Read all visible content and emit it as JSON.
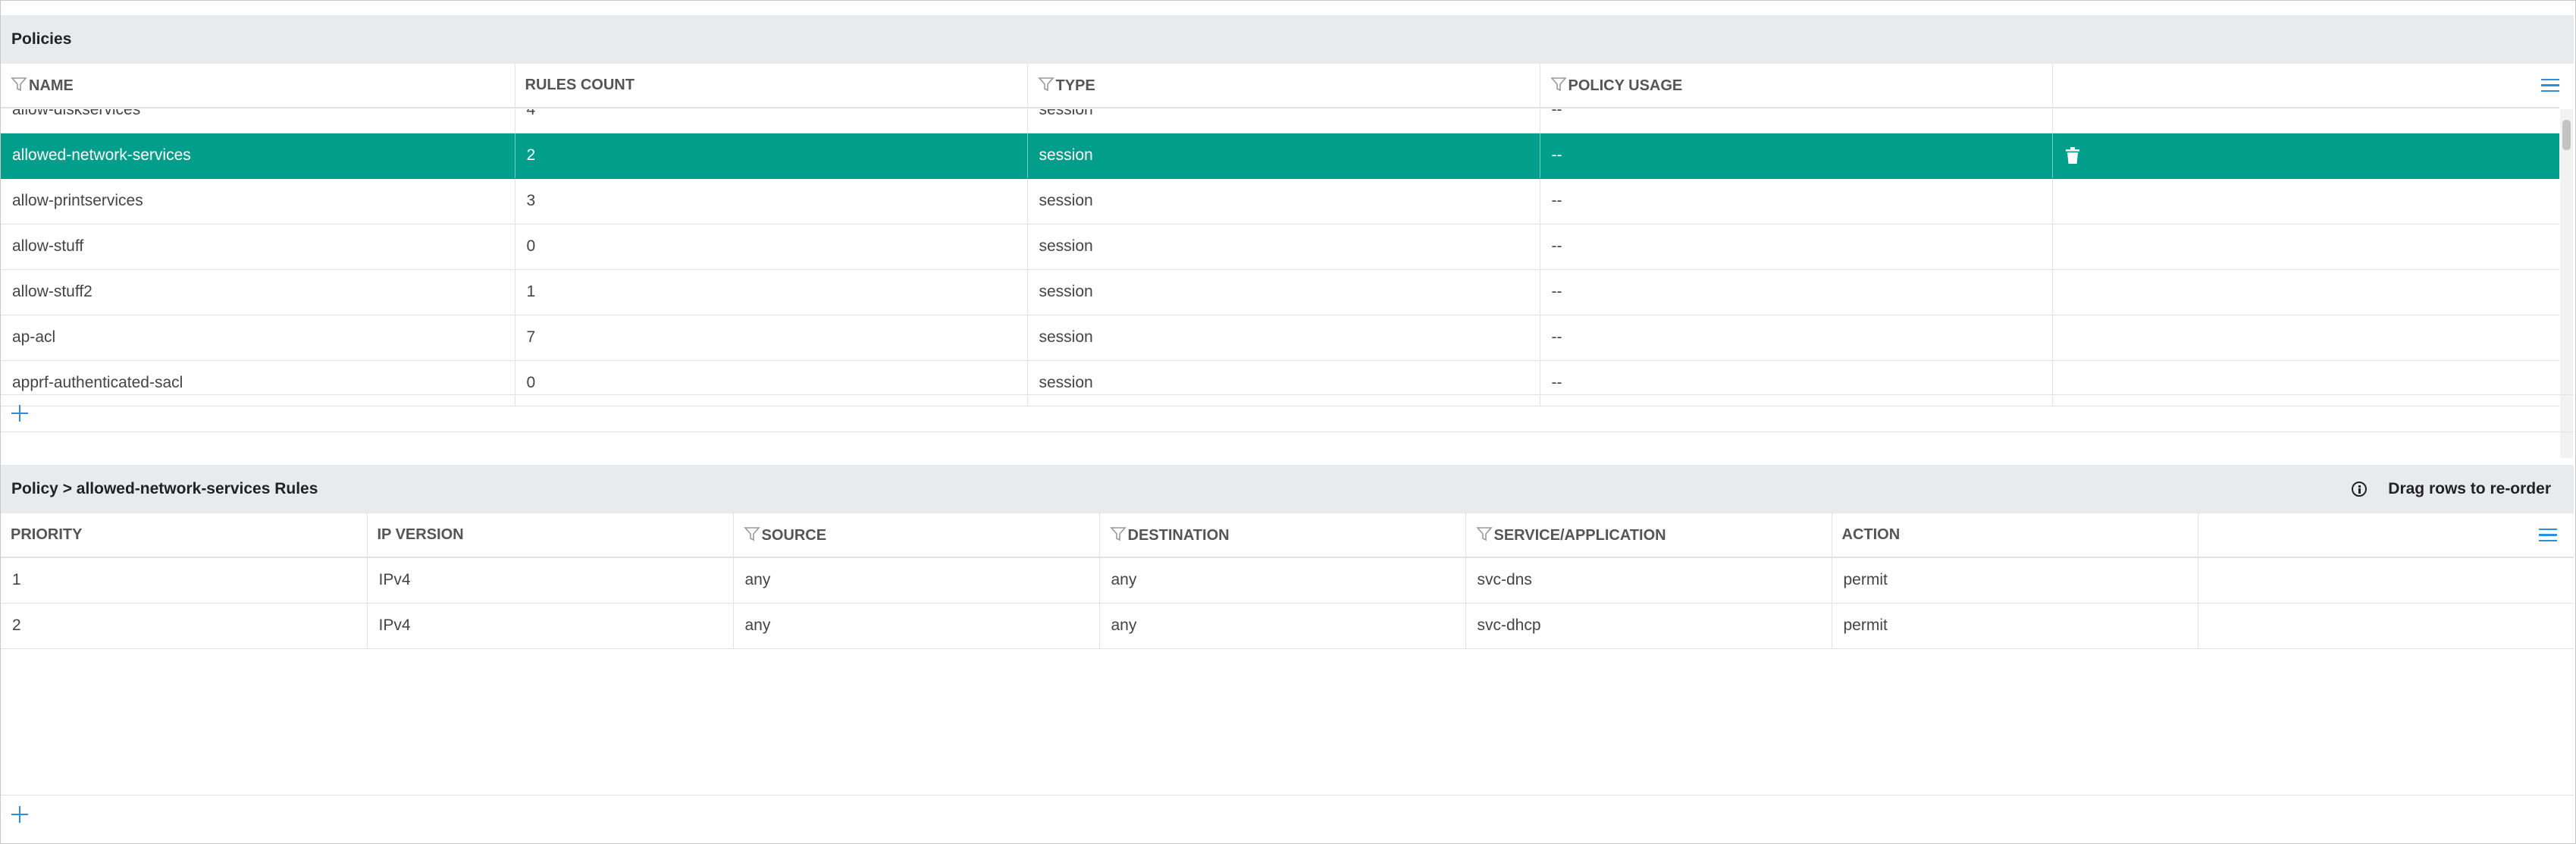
{
  "policies": {
    "title": "Policies",
    "columns": [
      {
        "label": "NAME",
        "filter": true
      },
      {
        "label": "RULES COUNT",
        "filter": false
      },
      {
        "label": "TYPE",
        "filter": true
      },
      {
        "label": "POLICY USAGE",
        "filter": true
      },
      {
        "label": "",
        "filter": false
      }
    ],
    "rows": [
      {
        "name": "allow-diskservices",
        "count": "4",
        "type": "session",
        "usage": "--",
        "selected": false
      },
      {
        "name": "allowed-network-services",
        "count": "2",
        "type": "session",
        "usage": "--",
        "selected": true
      },
      {
        "name": "allow-printservices",
        "count": "3",
        "type": "session",
        "usage": "--",
        "selected": false
      },
      {
        "name": "allow-stuff",
        "count": "0",
        "type": "session",
        "usage": "--",
        "selected": false
      },
      {
        "name": "allow-stuff2",
        "count": "1",
        "type": "session",
        "usage": "--",
        "selected": false
      },
      {
        "name": "ap-acl",
        "count": "7",
        "type": "session",
        "usage": "--",
        "selected": false
      },
      {
        "name": "apprf-authenticated-sacl",
        "count": "0",
        "type": "session",
        "usage": "--",
        "selected": false
      }
    ]
  },
  "rules": {
    "title": "Policy > allowed-network-services Rules",
    "hint": "Drag rows to re-order",
    "columns": [
      {
        "label": "PRIORITY",
        "filter": false
      },
      {
        "label": "IP VERSION",
        "filter": false
      },
      {
        "label": "SOURCE",
        "filter": true
      },
      {
        "label": "DESTINATION",
        "filter": true
      },
      {
        "label": "SERVICE/APPLICATION",
        "filter": true
      },
      {
        "label": "ACTION",
        "filter": false
      },
      {
        "label": "",
        "filter": false
      }
    ],
    "rows": [
      {
        "priority": "1",
        "ip_version": "IPv4",
        "source": "any",
        "destination": "any",
        "service": "svc-dns",
        "action": "permit"
      },
      {
        "priority": "2",
        "ip_version": "IPv4",
        "source": "any",
        "destination": "any",
        "service": "svc-dhcp",
        "action": "permit"
      }
    ]
  },
  "icons": {
    "filter": "filter-icon",
    "menu": "column-menu-icon",
    "add": "plus-icon",
    "delete": "trash-icon",
    "info": "info-icon"
  },
  "colors": {
    "selected_row": "#009e8b",
    "header_bg": "#e8ebee",
    "accent": "#2e8fd8"
  }
}
